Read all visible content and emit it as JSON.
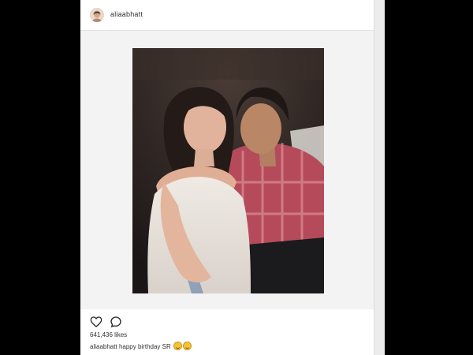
{
  "post": {
    "username": "aliaabhatt",
    "likes": "641,436 likes",
    "caption_user": "aliaabhatt",
    "caption_text": "happy birthday SR",
    "emojis": [
      "smiling-face-emoji",
      "smiling-face-emoji"
    ]
  },
  "icons": {
    "like": "heart-icon",
    "comment": "comment-icon"
  },
  "colors": {
    "page_background": "#000000",
    "post_background": "#f3f3f3",
    "header_background": "#ffffff",
    "text": "#333333"
  }
}
